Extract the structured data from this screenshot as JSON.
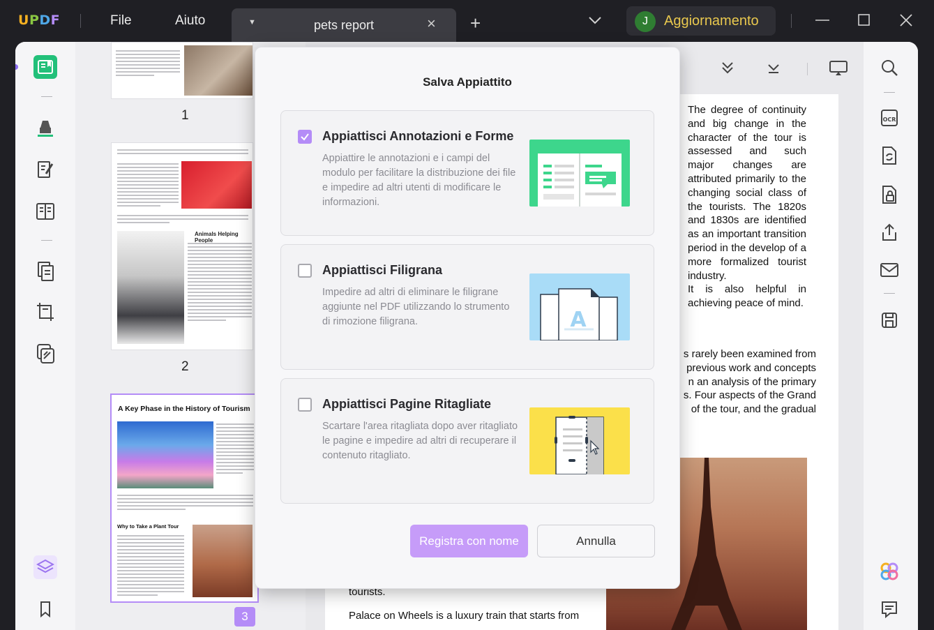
{
  "app": {
    "logo": "UPDF",
    "logo_colors": [
      "#f5b021",
      "#8ac642",
      "#4fa8e8",
      "#b48cf7"
    ]
  },
  "menu": {
    "file": "File",
    "help": "Aiuto"
  },
  "tab": {
    "title": "pets report"
  },
  "account": {
    "avatar_letter": "J",
    "upgrade_label": "Aggiornamento"
  },
  "thumbnails": [
    {
      "page": "1"
    },
    {
      "page": "2",
      "heading": "Animals Helping People"
    },
    {
      "page": "3",
      "heading": "A Key Phase in the History of Tourism",
      "subheading": "Why to Take a Plant Tour"
    }
  ],
  "document": {
    "para1": "The degree of continuity and big change in the character of the tour is assessed and such major changes are attributed primarily to the changing social class of the tourists. The 1820s and 1830s are identified as an important transition period in the develop of a more formalized tourist industry.",
    "para2": "It is also helpful in achieving peace of mind.",
    "para3": [
      "s rarely been examined from",
      "previous work and concepts",
      "n an analysis of the primary",
      "s. Four aspects of the Grand",
      "of the tour, and the gradual"
    ],
    "line_tourists": "tourists.",
    "line_palace": "Palace on Wheels is a luxury train that starts from"
  },
  "dialog": {
    "title": "Salva Appiattito",
    "options": [
      {
        "title": "Appiattisci Annotazioni e Forme",
        "desc": "Appiattire le annotazioni e i campi del modulo per facilitare la distribuzione dei file e impedire ad altri utenti di modificare le informazioni.",
        "checked": true,
        "illus_color": "#3dd68c"
      },
      {
        "title": "Appiattisci Filigrana",
        "desc": "Impedire ad altri di eliminare le filigrane aggiunte nel PDF utilizzando lo strumento di rimozione filigrana.",
        "checked": false,
        "illus_color": "#a9dcf7"
      },
      {
        "title": "Appiattisci Pagine Ritagliate",
        "desc": "Scartare l'area ritagliata dopo aver ritagliato le pagine e impedire ad altri di recuperare il contenuto ritagliato.",
        "checked": false,
        "illus_color": "#fbe04a"
      }
    ],
    "save_label": "Registra con nome",
    "cancel_label": "Annulla"
  },
  "colors": {
    "accent": "#b48cf7",
    "active_tool": "#22c07a",
    "upgrade": "#e9c84e"
  }
}
